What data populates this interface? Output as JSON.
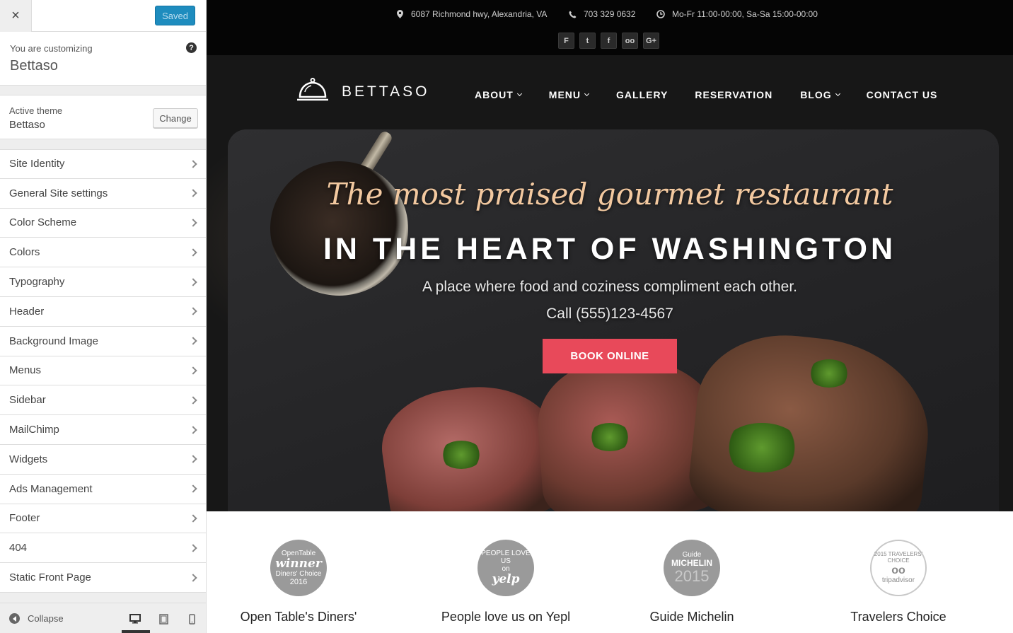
{
  "customizer": {
    "close_label": "×",
    "saved_label": "Saved",
    "customizing_label": "You are customizing",
    "site_title": "Bettaso",
    "help_label": "?",
    "active_theme_label": "Active theme",
    "active_theme_name": "Bettaso",
    "change_label": "Change",
    "sections": [
      {
        "label": "Site Identity"
      },
      {
        "label": "General Site settings"
      },
      {
        "label": "Color Scheme"
      },
      {
        "label": "Colors"
      },
      {
        "label": "Typography"
      },
      {
        "label": "Header"
      },
      {
        "label": "Background Image"
      },
      {
        "label": "Menus"
      },
      {
        "label": "Sidebar"
      },
      {
        "label": "MailChimp"
      },
      {
        "label": "Widgets"
      },
      {
        "label": "Ads Management"
      },
      {
        "label": "Footer"
      },
      {
        "label": "404"
      },
      {
        "label": "Static Front Page"
      }
    ],
    "collapse_label": "Collapse",
    "devices": [
      "desktop",
      "tablet",
      "mobile"
    ]
  },
  "topbar": {
    "address": "6087 Richmond hwy, Alexandria, VA",
    "phone": "703 329 0632",
    "hours": "Mo-Fr 11:00-00:00, Sa-Sa 15:00-00:00",
    "social": [
      {
        "icon": "foursquare-icon",
        "glyph": "F"
      },
      {
        "icon": "twitter-icon",
        "glyph": "t"
      },
      {
        "icon": "facebook-icon",
        "glyph": "f"
      },
      {
        "icon": "tripadvisor-icon",
        "glyph": "oo"
      },
      {
        "icon": "google-plus-icon",
        "glyph": "G+"
      }
    ]
  },
  "site": {
    "logo_text": "BETTASO",
    "nav": [
      {
        "label": "ABOUT",
        "dropdown": true
      },
      {
        "label": "MENU",
        "dropdown": true
      },
      {
        "label": "GALLERY",
        "dropdown": false
      },
      {
        "label": "RESERVATION",
        "dropdown": false
      },
      {
        "label": "BLOG",
        "dropdown": true
      },
      {
        "label": "CONTACT US",
        "dropdown": false
      }
    ]
  },
  "hero": {
    "tagline": "The most praised gourmet restaurant",
    "headline": "IN THE HEART OF WASHINGTON",
    "subline": "A place where food and coziness compliment each other.",
    "call": "Call (555)123-4567",
    "button": "BOOK ONLINE",
    "button_color": "#e8495a"
  },
  "awards": [
    {
      "title": "Open Table's Diners'",
      "badge_top": "OpenTable",
      "badge_main": "winner",
      "badge_sub": "Diners' Choice",
      "badge_year": "2016"
    },
    {
      "title": "People love us on Yepl",
      "badge_top": "PEOPLE LOVE US",
      "badge_main": "yelp",
      "badge_sub": "on",
      "badge_year": ""
    },
    {
      "title": "Guide Michelin",
      "badge_top": "Guide",
      "badge_main": "MICHELIN",
      "badge_sub": "",
      "badge_year": "2015"
    },
    {
      "title": "Travelers Choice",
      "badge_top": "2015 TRAVELERS' CHOICE",
      "badge_main": "oo",
      "badge_sub": "tripadvisor",
      "badge_year": ""
    }
  ]
}
